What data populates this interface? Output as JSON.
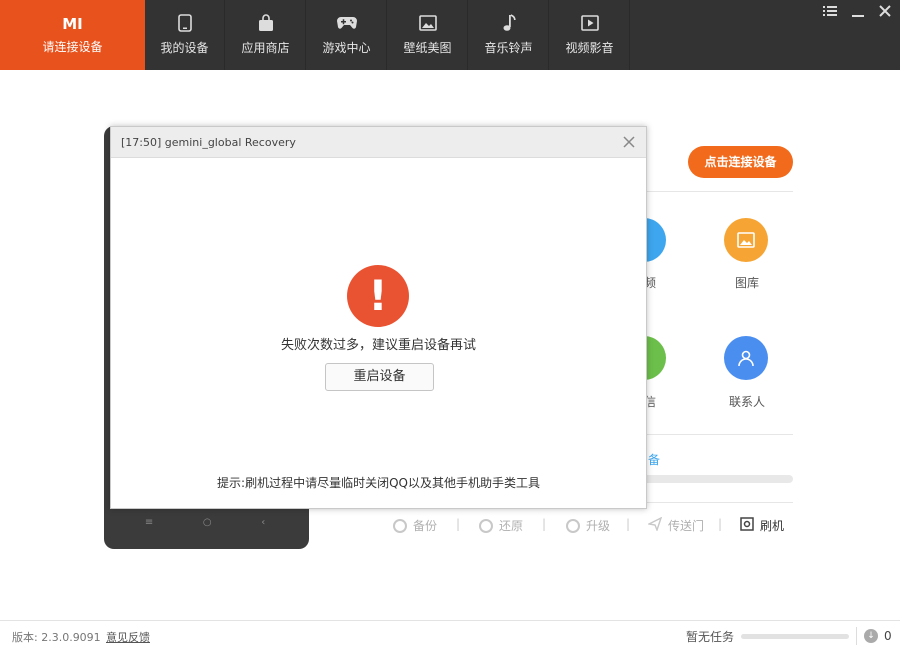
{
  "nav": {
    "brand_logo": "MI",
    "brand_label": "请连接设备",
    "tabs": [
      {
        "label": "我的设备",
        "icon": "phone-icon"
      },
      {
        "label": "应用商店",
        "icon": "shopping-bag-icon"
      },
      {
        "label": "游戏中心",
        "icon": "gamepad-icon"
      },
      {
        "label": "壁纸美图",
        "icon": "image-icon"
      },
      {
        "label": "音乐铃声",
        "icon": "music-note-icon"
      },
      {
        "label": "视频影音",
        "icon": "play-icon"
      }
    ],
    "accent_color": "#e8521c"
  },
  "main": {
    "connect_button": "点击连接设备",
    "apps": [
      {
        "label": "频",
        "color": "#3ea6ef"
      },
      {
        "label": "图库",
        "color": "#f6a534"
      },
      {
        "label": "信",
        "color": "#6cbf4a"
      },
      {
        "label": "联系人",
        "color": "#4a8ef0"
      }
    ],
    "backup_label": "备",
    "tools": [
      {
        "label": "备份"
      },
      {
        "label": "还原"
      },
      {
        "label": "升级"
      },
      {
        "label": "传送门"
      },
      {
        "label": "刷机"
      }
    ],
    "separator": "|"
  },
  "dialog": {
    "title": "[17:50] gemini_global Recovery",
    "warning_glyph": "!",
    "message": "失败次数过多，建议重启设备再试",
    "reboot_button": "重启设备",
    "tip": "提示:刷机过程中请尽量临时关闭QQ以及其他手机助手类工具"
  },
  "status": {
    "version": "版本: 2.3.0.9091",
    "feedback": "意见反馈",
    "no_task": "暂无任务",
    "download_count": "0"
  }
}
